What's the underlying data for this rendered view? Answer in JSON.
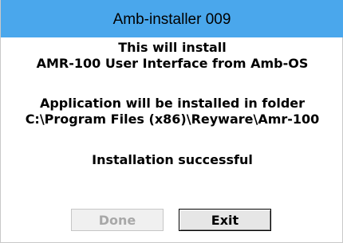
{
  "window": {
    "title": "Amb-installer 009"
  },
  "message": {
    "line1": "This will install",
    "line2": "AMR-100 User Interface from Amb-OS",
    "line3": "Application will be installed in folder",
    "line4": "C:\\Program Files (x86)\\Reyware\\Amr-100",
    "status": "Installation successful"
  },
  "buttons": {
    "done_label": "Done",
    "done_enabled": false,
    "exit_label": "Exit"
  },
  "colors": {
    "titlebar": "#4aa7ec",
    "background": "#ffffff",
    "disabled_text": "#a8a8a8"
  }
}
